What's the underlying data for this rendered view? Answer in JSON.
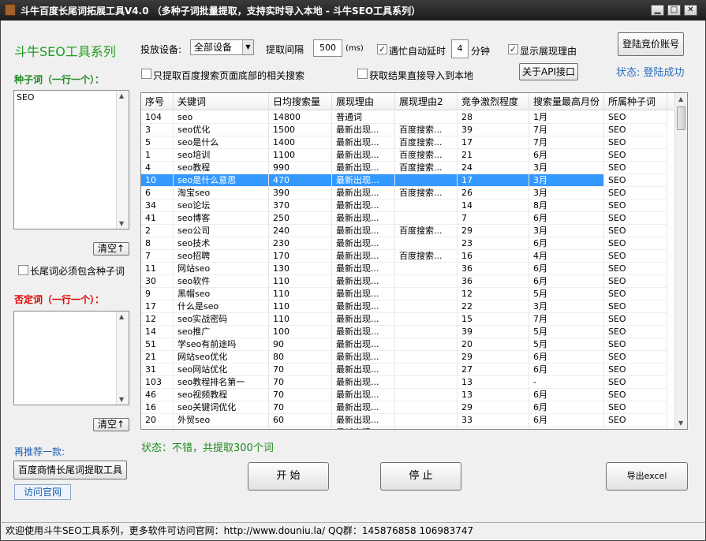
{
  "window": {
    "title": "斗牛百度长尾词拓展工具V4.0 （多种子词批量提取，支持实时导入本地 - 斗牛SEO工具系列）",
    "min_label": "▁",
    "max_label": "□",
    "close_label": "✕"
  },
  "brand": {
    "title": "斗牛SEO工具系列"
  },
  "toolbar": {
    "device_label": "投放设备:",
    "device_value": "全部设备",
    "interval_label": "提取间隔",
    "interval_value": "500",
    "interval_unit": "(ms)",
    "busy_delay_label": "遇忙自动延时",
    "busy_delay_checked": "✓",
    "delay_minutes_value": "4",
    "delay_unit": "分钟",
    "show_reason_label": "显示展现理由",
    "show_reason_checked": "✓",
    "login_button": "登陆竞价账号",
    "related_only_label": "只提取百度搜索页面底部的相关搜索",
    "related_only_checked": "",
    "import_local_label": "获取结果直接导入到本地",
    "import_local_checked": "",
    "api_button": "关于API接口",
    "status_label": "状态: 登陆成功"
  },
  "seed": {
    "label": "种子词（一行一个）：",
    "value": "SEO",
    "clear_button": "清空↑",
    "must_contain_label": "长尾词必须包含种子词",
    "must_contain_checked": ""
  },
  "negative": {
    "label": "否定词（一行一个）：",
    "value": "",
    "clear_button": "清空↑"
  },
  "recommend": {
    "label": "再推荐一款:",
    "tool_button": "百度商情长尾词提取工具",
    "site_button": "访问官网"
  },
  "grid": {
    "columns": [
      "序号",
      "关键词",
      "日均搜索量",
      "展现理由",
      "展现理由2",
      "竞争激烈程度",
      "搜索量最高月份",
      "所属种子词"
    ],
    "selected_index": 5,
    "rows": [
      [
        "104",
        "seo",
        "14800",
        "普通词",
        "",
        "28",
        "1月",
        "SEO"
      ],
      [
        "3",
        "seo优化",
        "1500",
        "最新出现...",
        "百度搜索...",
        "39",
        "7月",
        "SEO"
      ],
      [
        "5",
        "seo是什么",
        "1400",
        "最新出现...",
        "百度搜索...",
        "17",
        "7月",
        "SEO"
      ],
      [
        "1",
        "seo培训",
        "1100",
        "最新出现...",
        "百度搜索...",
        "21",
        "6月",
        "SEO"
      ],
      [
        "4",
        "seo教程",
        "990",
        "最新出现...",
        "百度搜索...",
        "24",
        "3月",
        "SEO"
      ],
      [
        "10",
        "seo是什么意思",
        "470",
        "最新出现...",
        "",
        "17",
        "3月",
        "SEO"
      ],
      [
        "6",
        "淘宝seo",
        "390",
        "最新出现...",
        "百度搜索...",
        "26",
        "3月",
        "SEO"
      ],
      [
        "34",
        "seo论坛",
        "370",
        "最新出现...",
        "",
        "14",
        "8月",
        "SEO"
      ],
      [
        "41",
        "seo博客",
        "250",
        "最新出现...",
        "",
        "7",
        "6月",
        "SEO"
      ],
      [
        "2",
        "seo公司",
        "240",
        "最新出现...",
        "百度搜索...",
        "29",
        "3月",
        "SEO"
      ],
      [
        "8",
        "seo技术",
        "230",
        "最新出现...",
        "",
        "23",
        "6月",
        "SEO"
      ],
      [
        "7",
        "seo招聘",
        "170",
        "最新出现...",
        "百度搜索...",
        "16",
        "4月",
        "SEO"
      ],
      [
        "11",
        "网站seo",
        "130",
        "最新出现...",
        "",
        "36",
        "6月",
        "SEO"
      ],
      [
        "30",
        "seo软件",
        "110",
        "最新出现...",
        "",
        "36",
        "6月",
        "SEO"
      ],
      [
        "9",
        "黑帽seo",
        "110",
        "最新出现...",
        "",
        "12",
        "5月",
        "SEO"
      ],
      [
        "17",
        "什么是seo",
        "110",
        "最新出现...",
        "",
        "22",
        "3月",
        "SEO"
      ],
      [
        "12",
        "seo实战密码",
        "110",
        "最新出现...",
        "",
        "15",
        "7月",
        "SEO"
      ],
      [
        "14",
        "seo推广",
        "100",
        "最新出现...",
        "",
        "39",
        "5月",
        "SEO"
      ],
      [
        "51",
        "学seo有前途吗",
        "90",
        "最新出现...",
        "",
        "20",
        "5月",
        "SEO"
      ],
      [
        "21",
        "网站seo优化",
        "80",
        "最新出现...",
        "",
        "29",
        "6月",
        "SEO"
      ],
      [
        "31",
        "seo网站优化",
        "70",
        "最新出现...",
        "",
        "27",
        "6月",
        "SEO"
      ],
      [
        "103",
        "seo教程排名第一",
        "70",
        "最新出现...",
        "",
        "13",
        "-",
        "SEO"
      ],
      [
        "46",
        "seo视频教程",
        "70",
        "最新出现...",
        "",
        "13",
        "6月",
        "SEO"
      ],
      [
        "16",
        "seo关键词优化",
        "70",
        "最新出现...",
        "",
        "29",
        "6月",
        "SEO"
      ],
      [
        "20",
        "外贸seo",
        "60",
        "最新出现...",
        "",
        "33",
        "6月",
        "SEO"
      ],
      [
        "",
        "",
        "",
        "最新出现...",
        "",
        "",
        "",
        ""
      ]
    ]
  },
  "result_status": "状态：不错，共提取300个词",
  "actions": {
    "start": "开  始",
    "stop": "停  止",
    "export": "导出excel"
  },
  "statusbar": {
    "text": "欢迎使用斗牛SEO工具系列，更多软件可访问官网：http://www.douniu.la/ QQ群：145876858  106983747"
  },
  "colors": {
    "selection": "#3399ff",
    "brand_green": "#1f9e1f",
    "negative_red": "#e00000",
    "status_blue": "#2a6fbf"
  }
}
